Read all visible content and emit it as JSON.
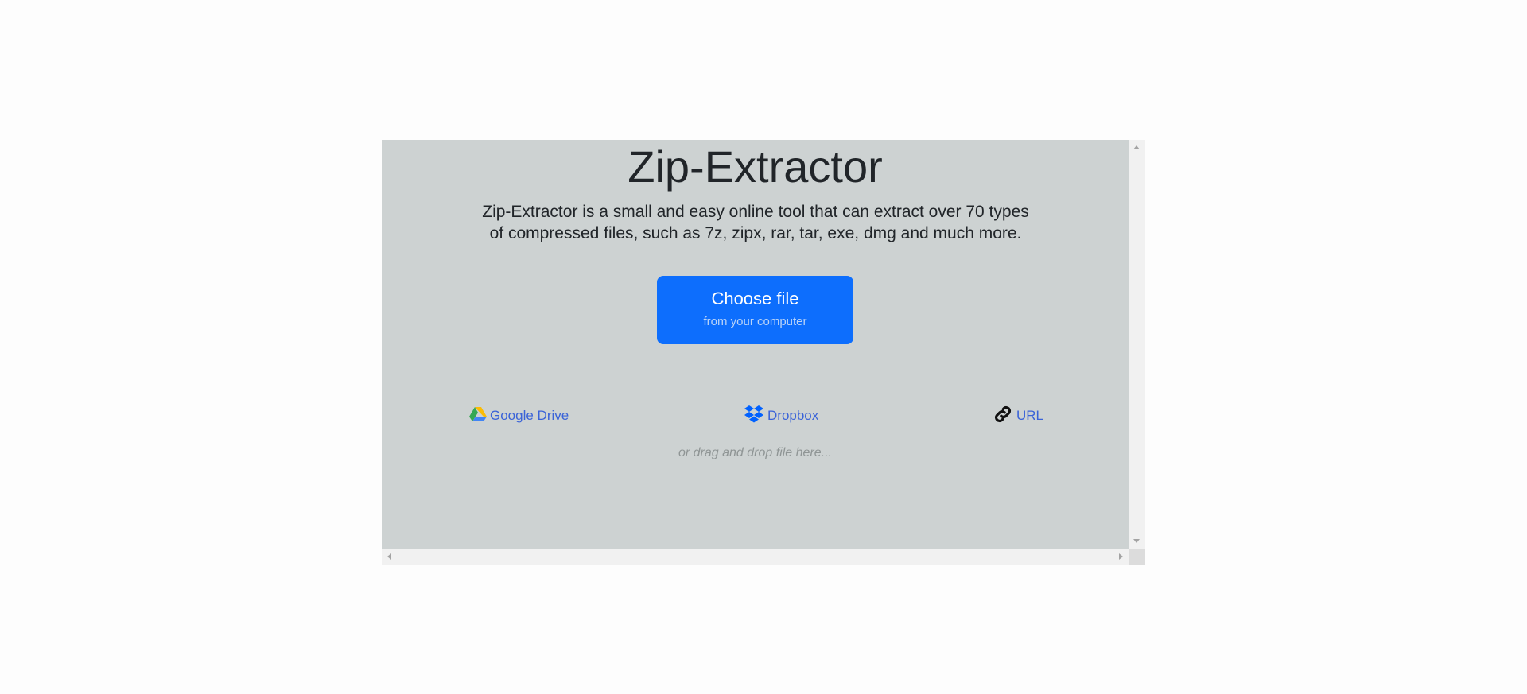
{
  "hero": {
    "title": "Zip-Extractor",
    "description": "Zip-Extractor is a small and easy online tool that can extract over 70 types of compressed files, such as 7z, zipx, rar, tar, exe, dmg and much more."
  },
  "upload": {
    "choose_label": "Choose file",
    "choose_sublabel": "from your computer",
    "accent_color": "#0d6efd"
  },
  "sources": [
    {
      "label": "Google Drive",
      "icon": "google-drive-icon"
    },
    {
      "label": "Dropbox",
      "icon": "dropbox-icon"
    },
    {
      "label": "URL",
      "icon": "link-icon"
    }
  ],
  "drop_hint": "or drag and drop file here..."
}
